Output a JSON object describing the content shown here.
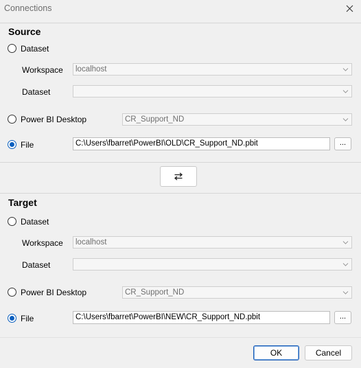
{
  "window": {
    "title": "Connections"
  },
  "source": {
    "heading": "Source",
    "dataset_radio_label": "Dataset",
    "workspace_label": "Workspace",
    "workspace_value": "localhost",
    "dataset_label": "Dataset",
    "dataset_value": "",
    "pbi_desktop_label": "Power BI Desktop",
    "pbi_desktop_value": "CR_Support_ND",
    "file_label": "File",
    "file_path": "C:\\Users\\fbarret\\PowerBI\\OLD\\CR_Support_ND.pbit",
    "browse_label": "...",
    "selected": "file"
  },
  "target": {
    "heading": "Target",
    "dataset_radio_label": "Dataset",
    "workspace_label": "Workspace",
    "workspace_value": "localhost",
    "dataset_label": "Dataset",
    "dataset_value": "",
    "pbi_desktop_label": "Power BI Desktop",
    "pbi_desktop_value": "CR_Support_ND",
    "file_label": "File",
    "file_path": "C:\\Users\\fbarret\\PowerBI\\NEW\\CR_Support_ND.pbit",
    "browse_label": "...",
    "selected": "file"
  },
  "icons": {
    "close": "close-icon",
    "swap": "swap-icon",
    "dropdown": "chevron-down-icon"
  },
  "footer": {
    "ok_label": "OK",
    "cancel_label": "Cancel"
  }
}
